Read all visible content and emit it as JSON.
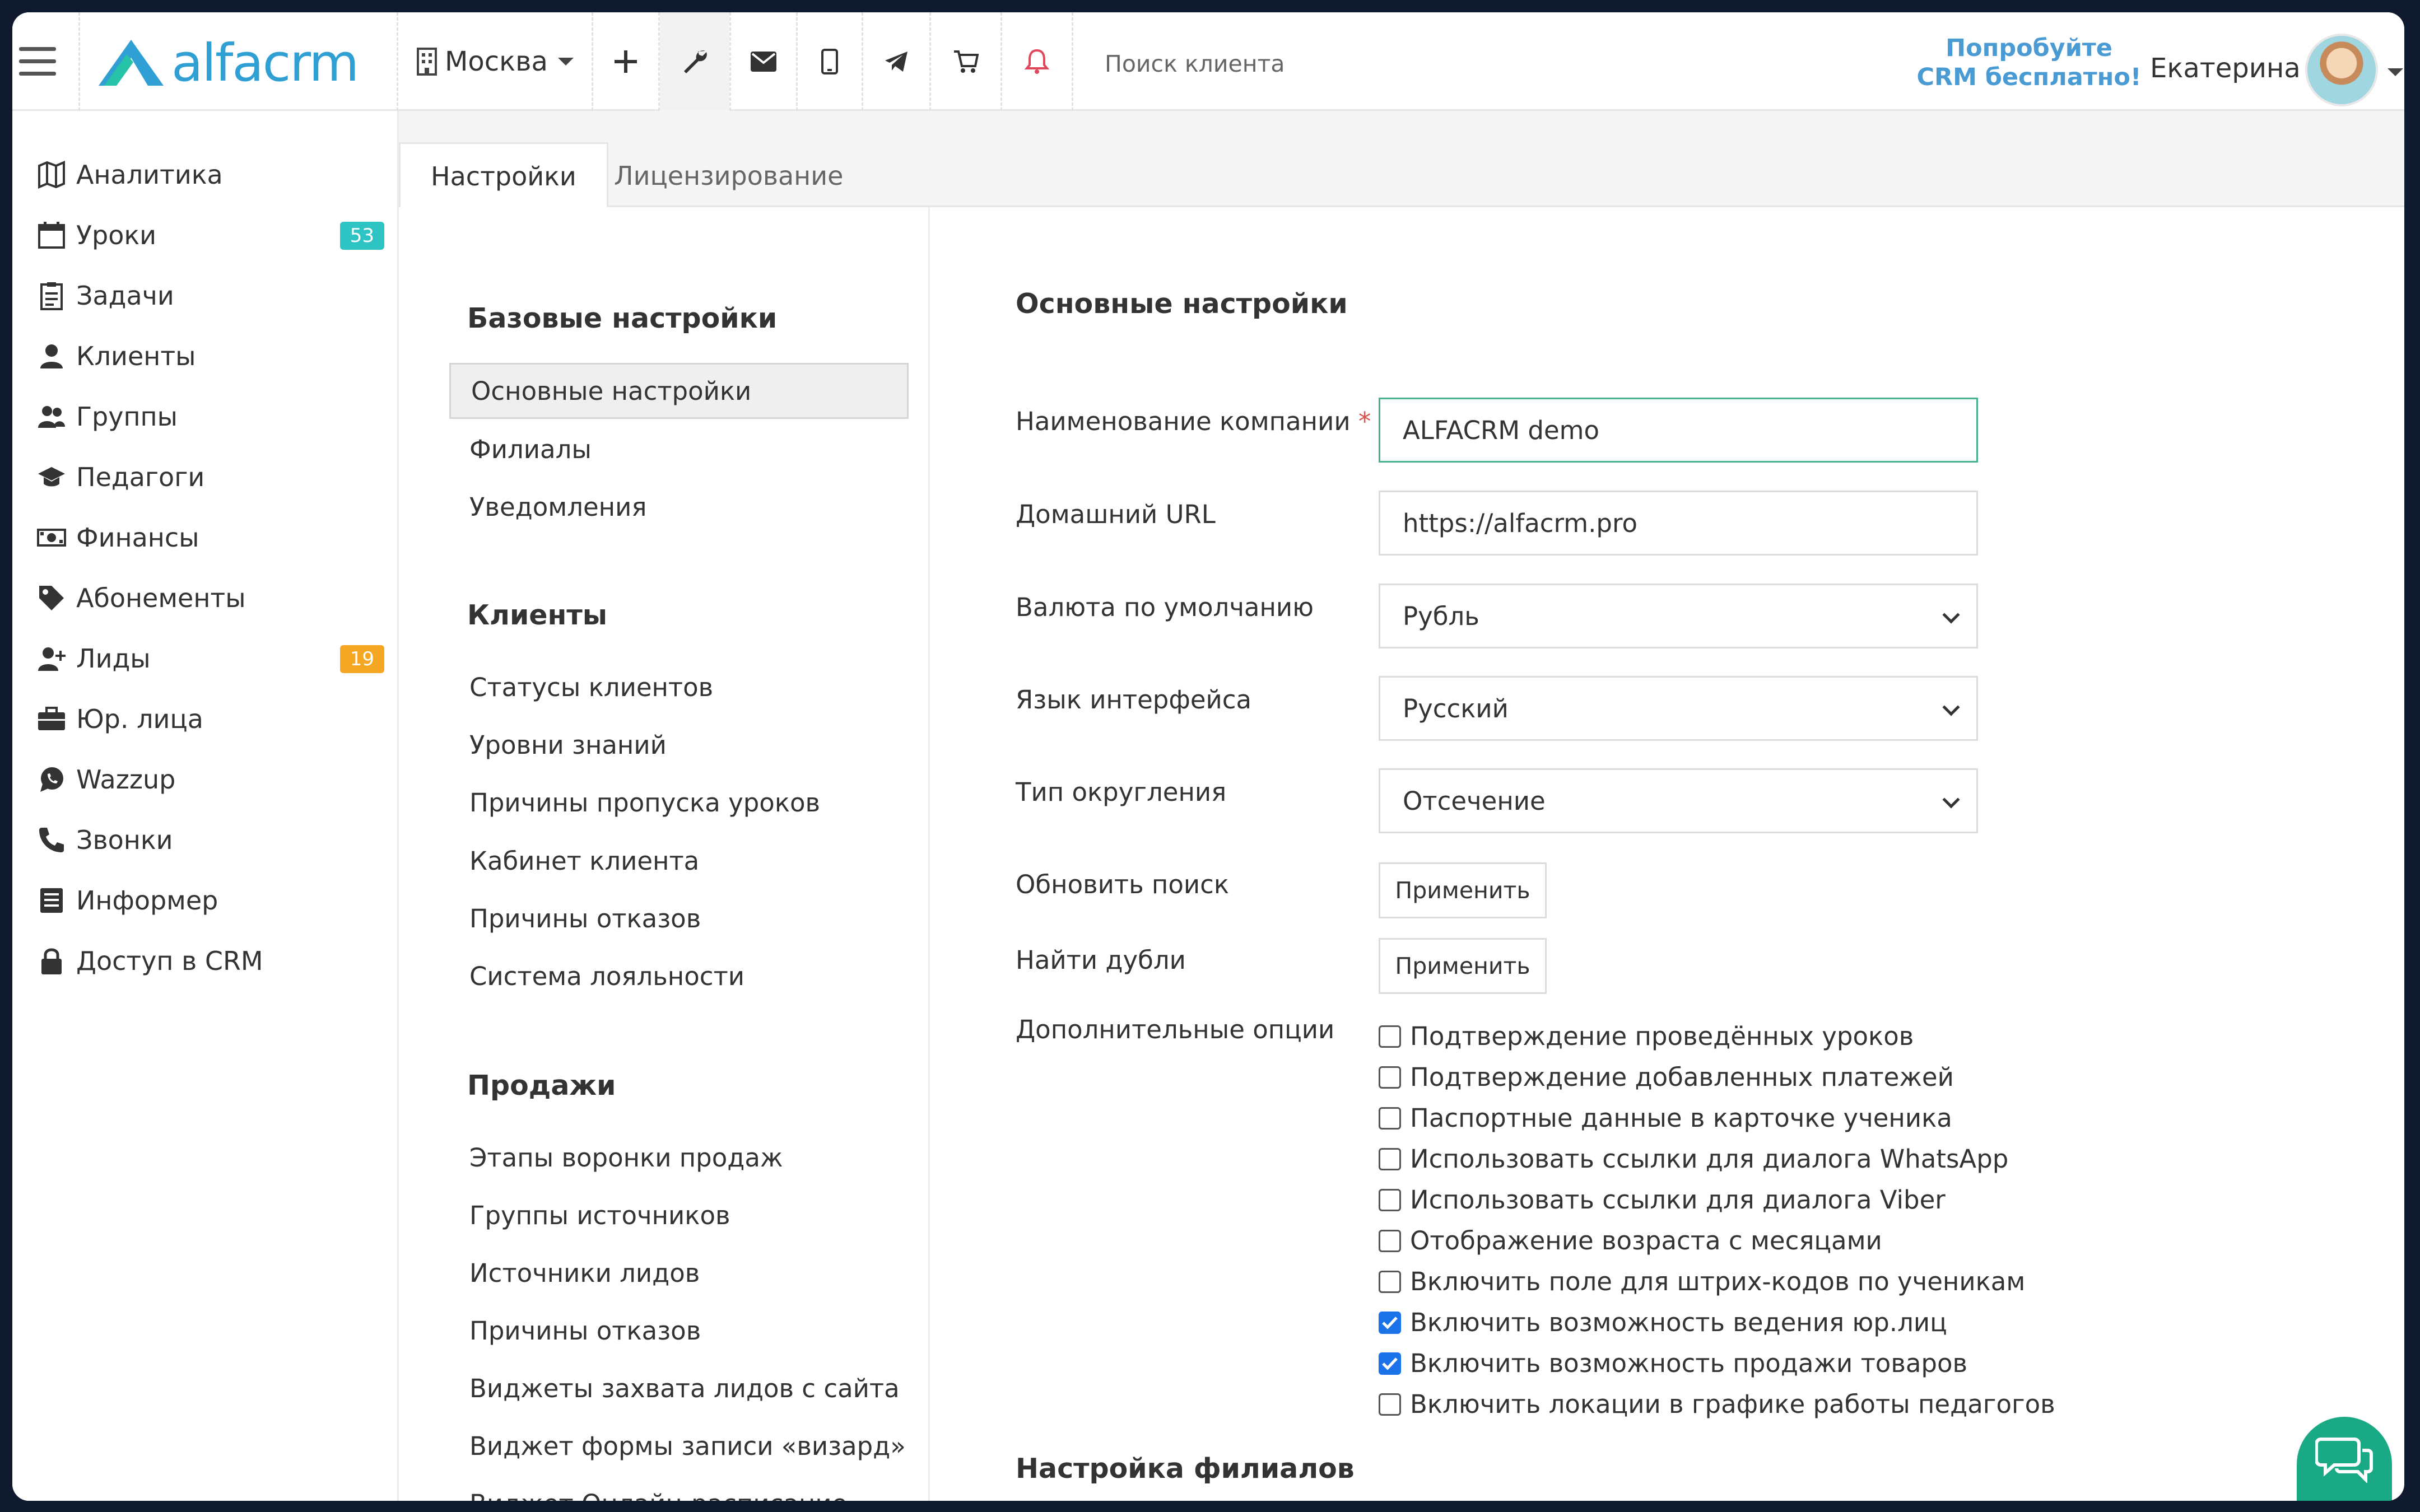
{
  "header": {
    "logo_text": "alfacrm",
    "branch": "Москва",
    "search_placeholder": "Поиск клиента",
    "promo_line1": "Попробуйте",
    "promo_line2": "CRM бесплатно!",
    "user_name": "Екатерина",
    "icons": [
      "plus-icon",
      "wrench-icon",
      "mail-icon",
      "mobile-icon",
      "telegram-icon",
      "cart-icon",
      "bell-icon"
    ]
  },
  "sidebar": {
    "items": [
      {
        "label": "Аналитика",
        "icon": "map-icon"
      },
      {
        "label": "Уроки",
        "icon": "calendar-icon",
        "badge": "53",
        "badge_color": "#2ec4c4"
      },
      {
        "label": "Задачи",
        "icon": "clipboard-icon"
      },
      {
        "label": "Клиенты",
        "icon": "user-icon"
      },
      {
        "label": "Группы",
        "icon": "users-icon"
      },
      {
        "label": "Педагоги",
        "icon": "graduation-cap-icon"
      },
      {
        "label": "Финансы",
        "icon": "money-icon"
      },
      {
        "label": "Абонементы",
        "icon": "tag-icon"
      },
      {
        "label": "Лиды",
        "icon": "user-plus-icon",
        "badge": "19",
        "badge_color": "#f5a623"
      },
      {
        "label": "Юр. лица",
        "icon": "briefcase-icon"
      },
      {
        "label": "Wazzup",
        "icon": "whatsapp-icon"
      },
      {
        "label": "Звонки",
        "icon": "phone-icon"
      },
      {
        "label": "Информер",
        "icon": "list-icon"
      },
      {
        "label": "Доступ в CRM",
        "icon": "lock-icon"
      }
    ]
  },
  "tabs": [
    {
      "label": "Настройки",
      "active": true
    },
    {
      "label": "Лицензирование",
      "active": false
    }
  ],
  "settings_nav": {
    "groups": [
      {
        "title": "Базовые настройки",
        "items": [
          "Основные настройки",
          "Филиалы",
          "Уведомления"
        ]
      },
      {
        "title": "Клиенты",
        "items": [
          "Статусы клиентов",
          "Уровни знаний",
          "Причины пропуска уроков",
          "Кабинет клиента",
          "Причины отказов",
          "Система лояльности"
        ]
      },
      {
        "title": "Продажи",
        "items": [
          "Этапы воронки продаж",
          "Группы источников",
          "Источники лидов",
          "Причины отказов",
          "Виджеты захвата лидов с сайта",
          "Виджет формы записи «визард»",
          "Виджет Онлайн-расписание"
        ]
      }
    ],
    "active_item": "Основные настройки"
  },
  "form": {
    "title": "Основные настройки",
    "company_label": "Наименование компании",
    "required_mark": "*",
    "company_value": "ALFACRM demo",
    "url_label": "Домашний URL",
    "url_value": "https://alfacrm.pro",
    "currency_label": "Валюта по умолчанию",
    "currency_value": "Рубль",
    "language_label": "Язык интерфейса",
    "language_value": "Русский",
    "rounding_label": "Тип округления",
    "rounding_value": "Отсечение",
    "refresh_label": "Обновить поиск",
    "refresh_button": "Применить",
    "dupes_label": "Найти дубли",
    "dupes_button": "Применить",
    "options_label": "Дополнительные опции",
    "options": [
      {
        "label": "Подтверждение проведённых уроков",
        "checked": false
      },
      {
        "label": "Подтверждение добавленных платежей",
        "checked": false
      },
      {
        "label": "Паспортные данные в карточке ученика",
        "checked": false
      },
      {
        "label": "Использовать ссылки для диалога WhatsApp",
        "checked": false
      },
      {
        "label": "Использовать ссылки для диалога Viber",
        "checked": false
      },
      {
        "label": "Отображение возраста с месяцами",
        "checked": false
      },
      {
        "label": "Включить поле для штрих-кодов по ученикам",
        "checked": false
      },
      {
        "label": "Включить возможность ведения юр.лиц",
        "checked": true
      },
      {
        "label": "Включить возможность продажи товаров",
        "checked": true
      },
      {
        "label": "Включить локации в графике работы педагогов",
        "checked": false
      }
    ],
    "next_section": "Настройка филиалов"
  },
  "colors": {
    "accent": "#2f9fd4",
    "focus_border": "#47b28a",
    "chat": "#1aa985",
    "checkbox": "#1a73e8"
  }
}
